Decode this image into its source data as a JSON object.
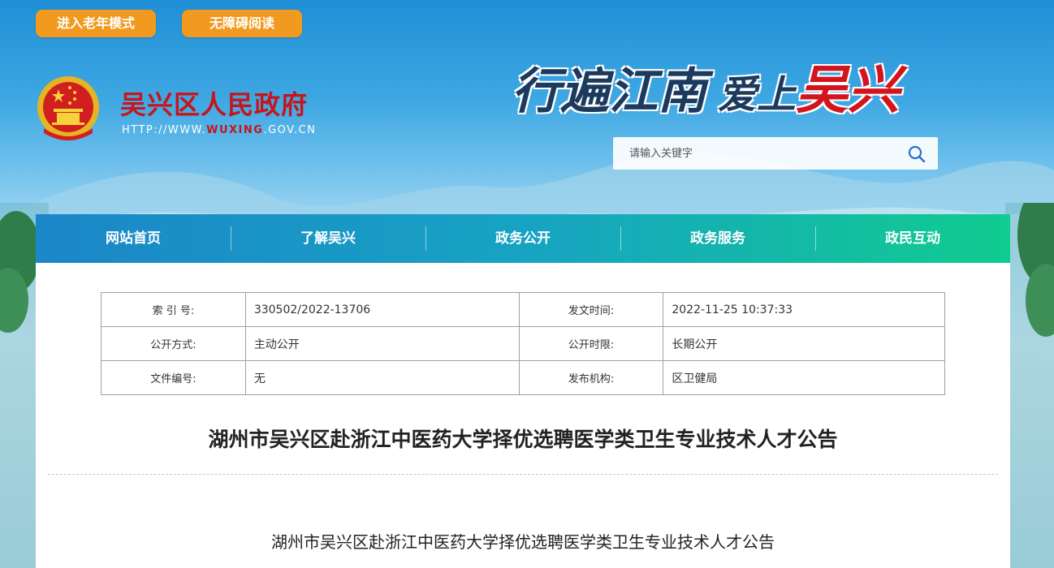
{
  "top_buttons": {
    "elder_mode": "进入老年模式",
    "accessible": "无障碍阅读"
  },
  "header": {
    "site_title": "吴兴区人民政府",
    "url_prefix": "HTTP://WWW.",
    "url_highlight": "WUXING",
    "url_suffix": ".GOV.CN",
    "slogan_part1": "行遍江南",
    "slogan_part2": "爱上",
    "slogan_part3": "吴兴"
  },
  "search": {
    "placeholder": "请输入关键字"
  },
  "nav": {
    "items": [
      "网站首页",
      "了解吴兴",
      "政务公开",
      "政务服务",
      "政民互动"
    ]
  },
  "info_table": {
    "rows": [
      {
        "k1": "索 引 号:",
        "v1": "330502/2022-13706",
        "k2": "发文时间:",
        "v2": "2022-11-25 10:37:33"
      },
      {
        "k1": "公开方式:",
        "v1": "主动公开",
        "k2": "公开时限:",
        "v2": "长期公开"
      },
      {
        "k1": "文件编号:",
        "v1": "无",
        "k2": "发布机构:",
        "v2": "区卫健局"
      }
    ]
  },
  "article": {
    "title": "湖州市吴兴区赴浙江中医药大学择优选聘医学类卫生专业技术人才公告",
    "body_title": "湖州市吴兴区赴浙江中医药大学择优选聘医学类卫生专业技术人才公告"
  },
  "colors": {
    "accent_orange": "#f29a1f",
    "title_red": "#c8141b",
    "nav_start": "#1b86c8",
    "nav_end": "#10cc8f"
  }
}
